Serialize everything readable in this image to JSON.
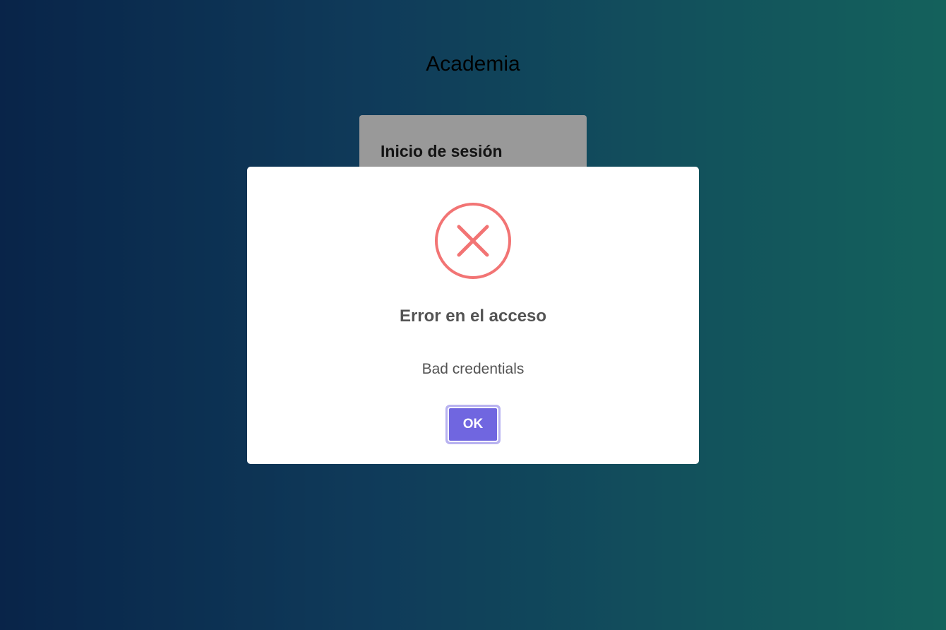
{
  "app": {
    "title": "Academia"
  },
  "login_card": {
    "title": "Inicio de sesión"
  },
  "modal": {
    "icon": "error-x-icon",
    "icon_color": "#f27474",
    "title": "Error en el acceso",
    "message": "Bad credentials",
    "confirm_label": "OK",
    "confirm_color": "#7066e0"
  },
  "colors": {
    "gradient_start": "#0f3d7a",
    "gradient_end": "#22a39a",
    "overlay": "rgba(0,0,0,0.4)"
  }
}
